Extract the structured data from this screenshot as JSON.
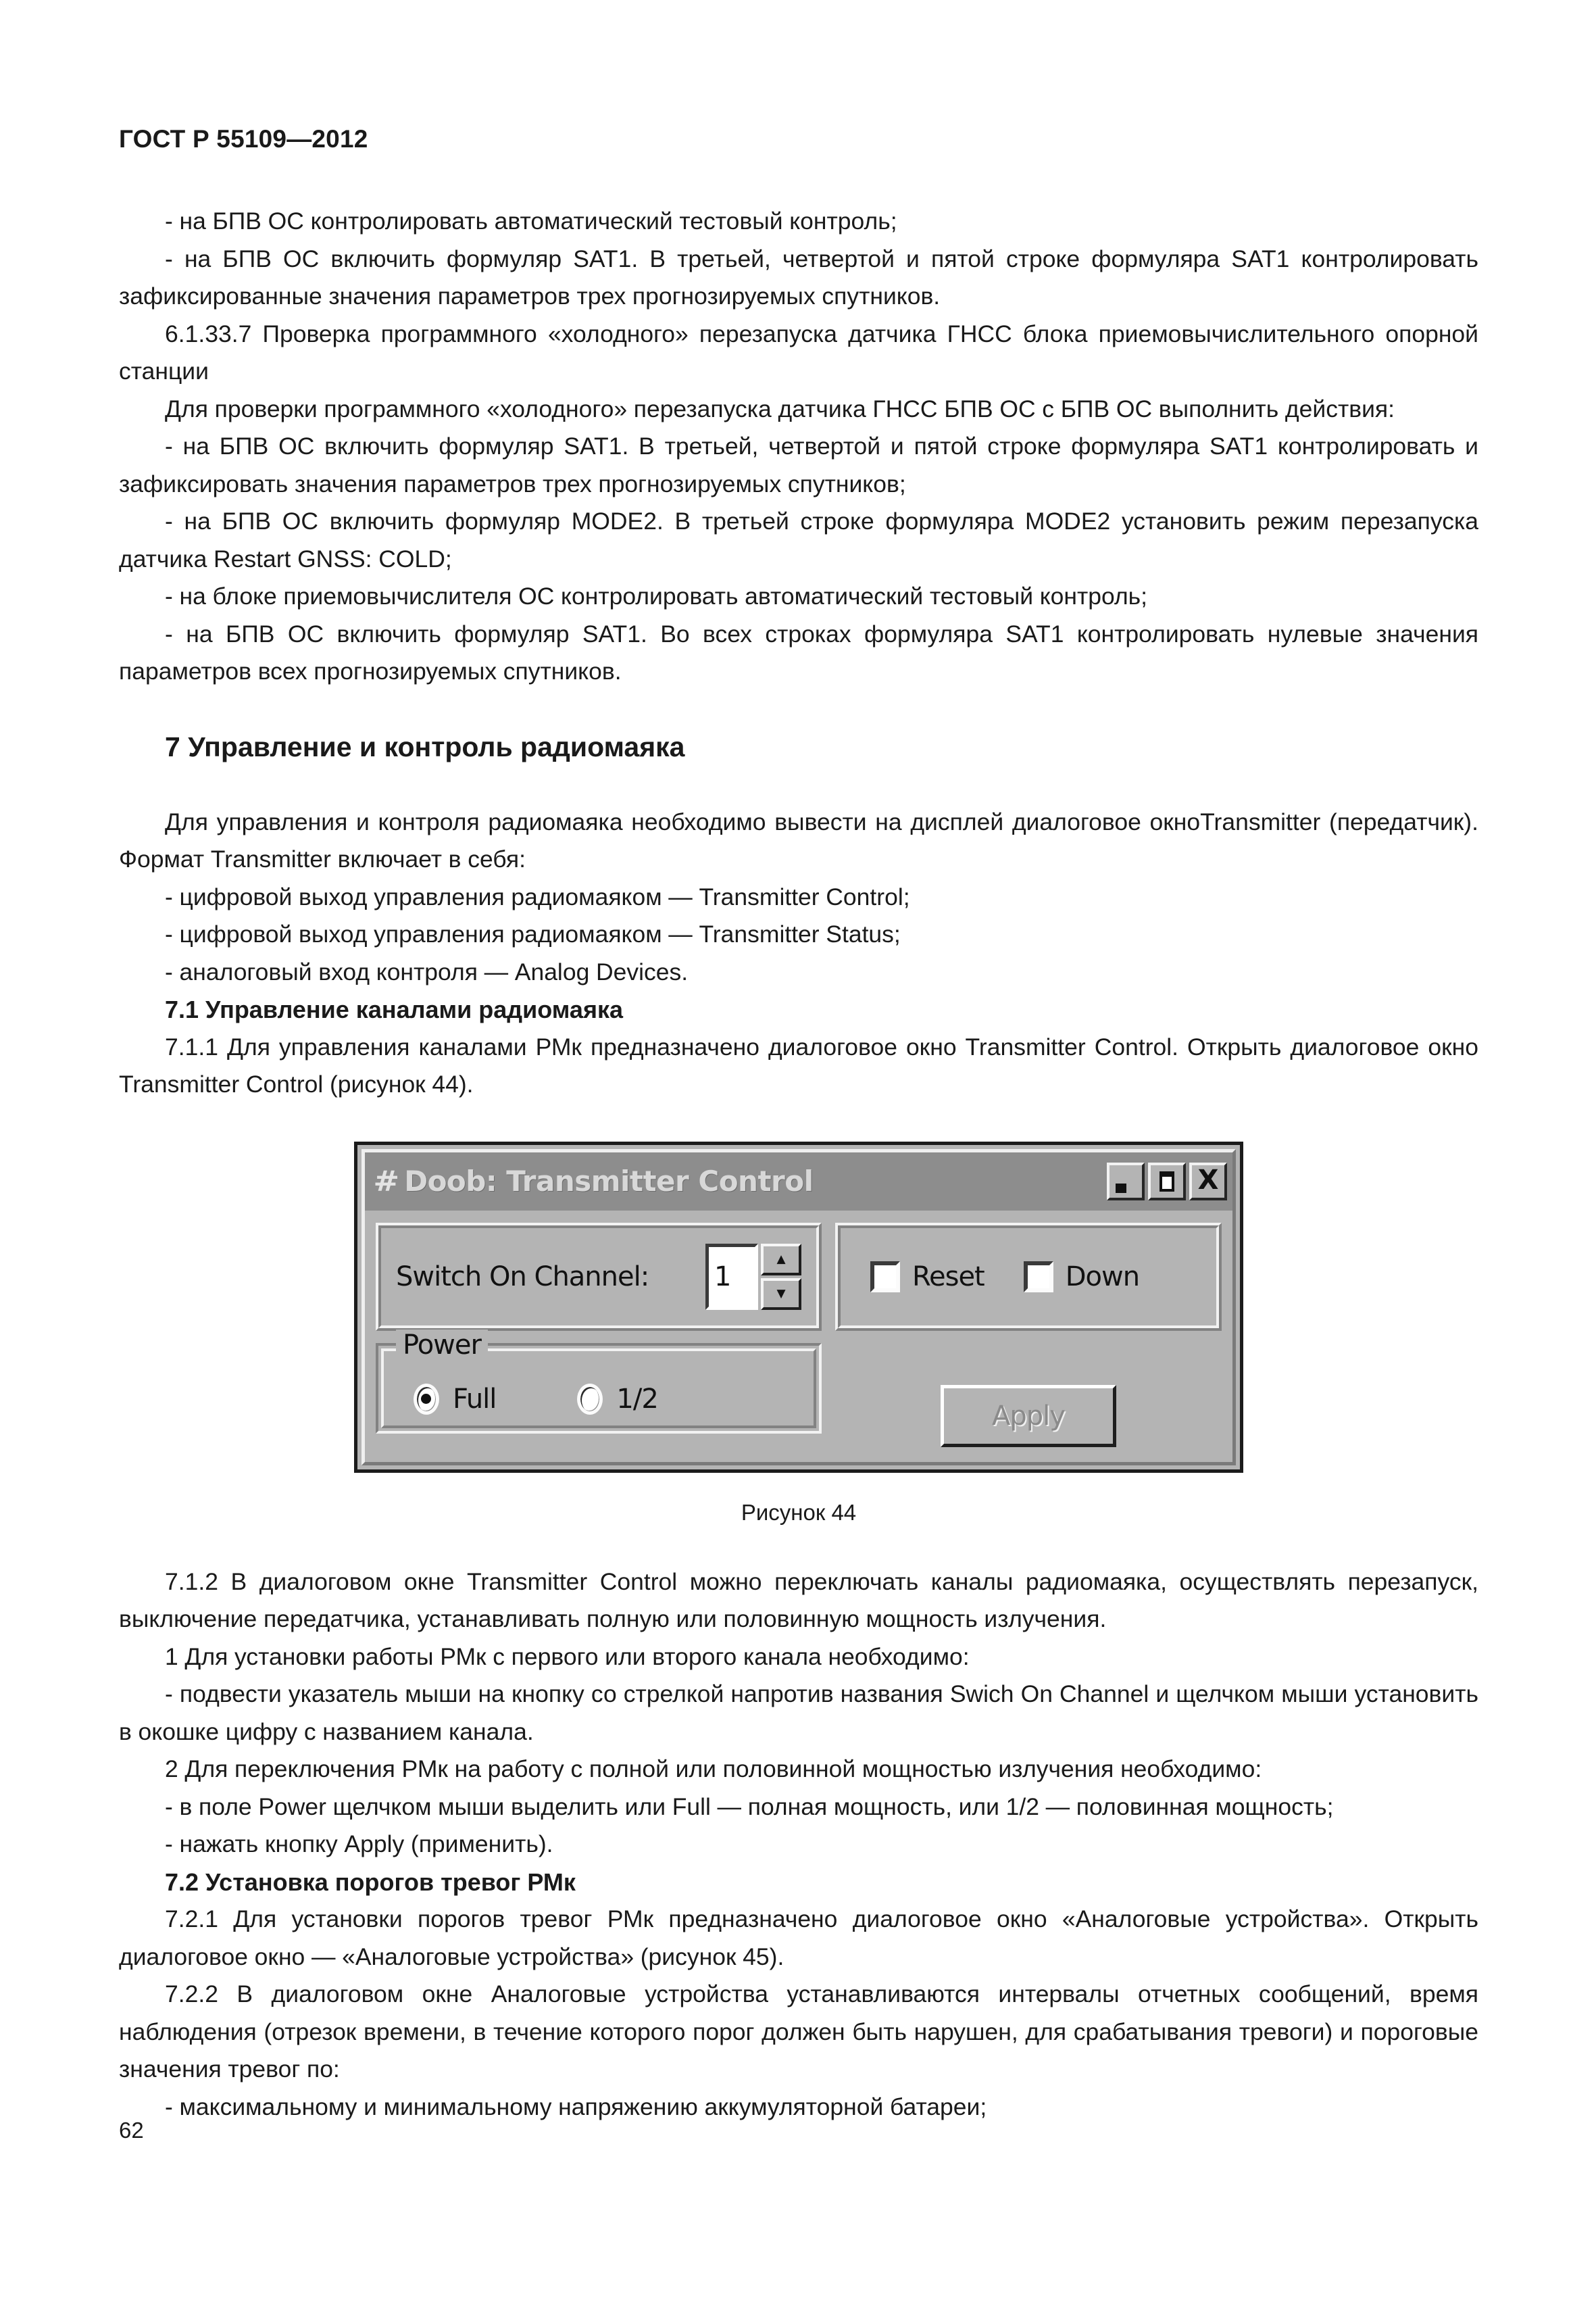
{
  "document": {
    "header": "ГОСТ Р 55109—2012",
    "page_number": "62"
  },
  "body": {
    "para_1": "- на БПВ ОС контролировать автоматический тестовый контроль;",
    "para_2": "- на БПВ ОС включить формуляр SAT1. В третьей, четвертой и пятой строке формуляра SAT1 контролировать  зафиксированные значения параметров трех прогнозируемых спутников.",
    "para_3": "6.1.33.7 Проверка  программного «холодного» перезапуска датчика ГНСС блока приемовычислительного опорной станции",
    "para_4": "Для проверки программного «холодного» перезапуска датчика ГНСС БПВ ОС с БПВ ОС выполнить действия:",
    "para_5": "- на БПВ ОС включить формуляр SAT1. В третьей, четвертой и пятой строке формуляра SAT1 контролировать и зафиксировать значения параметров трех прогнозируемых спутников;",
    "para_6": "- на БПВ ОС включить формуляр MODE2. В третьей строке формуляра MODE2 установить режим перезапуска датчика Restart GNSS: COLD;",
    "para_7": "- на блоке приемовычислителя ОС контролировать автоматический тестовый контроль;",
    "para_8": "- на БПВ ОС включить формуляр SAT1. Во всех строках формуляра SAT1 контролировать нулевые значения параметров всех прогнозируемых спутников.",
    "section_7_title": "7 Управление и контроль радиомаяка",
    "para_9": "Для управления и контроля радиомаяка необходимо вывести на дисплей диалоговое окноTransmitter (передатчик). Формат Transmitter включает в себя:",
    "para_10": "- цифровой выход управления радиомаяком — Transmitter Control;",
    "para_11": "- цифровой выход управления радиомаяком — Transmitter Status;",
    "para_12": "- аналоговый вход контроля — Analog Devices.",
    "section_71_title": "7.1 Управление каналами радиомаяка",
    "para_13": "7.1.1 Для управления каналами РМк предназначено диалоговое окно Transmitter Control. Открыть диалоговое окно Transmitter Control (рисунок 44).",
    "figure_caption": "Рисунок 44",
    "para_14": "7.1.2 В диалоговом окне Transmitter Control можно переключать каналы радиомаяка, осуществлять перезапуск, выключение передатчика, устанавливать полную или половинную мощность излучения.",
    "para_15": "1 Для установки работы РМк с первого или второго канала необходимо:",
    "para_16": "- подвести указатель мыши на кнопку со стрелкой напротив названия Swich On Channel и щелчком мыши установить в окошке цифру с названием канала.",
    "para_17": "2 Для переключения РМк на работу с полной или половинной мощностью излучения необходимо:",
    "para_18": "- в поле Power щелчком мыши выделить или Full — полная мощность, или 1/2 — половинная мощность;",
    "para_19": "- нажать кнопку Apply (применить).",
    "section_72_title": "7.2 Установка порогов тревог РМк",
    "para_20": "7.2.1 Для установки порогов тревог РМк предназначено диалоговое окно «Аналоговые устройства». Открыть диалоговое окно — «Аналоговые устройства» (рисунок 45).",
    "para_21": "7.2.2 В диалоговом окне Аналоговые устройства устанавливаются интервалы отчетных сообщений, время наблюдения (отрезок времени, в течение которого порог должен быть нарушен, для срабатывания тревоги) и пороговые значения тревог по:",
    "para_22": "- максимальному и минимальному напряжению аккумуляторной батареи;"
  },
  "dialog": {
    "title": "Doob: Transmitter Control",
    "title_icon": "hash-icon",
    "minimize_label": "",
    "maximize_label": "",
    "close_label": "X",
    "channel_label": "Switch On Channel:",
    "channel_value": "1",
    "spin_up": "▲",
    "spin_down": "▼",
    "reset_label": "Reset",
    "reset_checked": false,
    "down_label": "Down",
    "down_checked": false,
    "power_group_label": "Power",
    "power_full_label": "Full",
    "power_half_label": "1/2",
    "power_selected": "Full",
    "apply_label": "Apply",
    "apply_enabled": false,
    "colors": {
      "face": "#b4b4b4",
      "titlebar": "#8d8d8d",
      "title_text": "#d8d8d8",
      "shadow": "#828282",
      "highlight": "#f2f2f2",
      "dark": "#1e1e1e",
      "field": "#ffffff",
      "disabled_text": "#8a8a8a"
    }
  }
}
